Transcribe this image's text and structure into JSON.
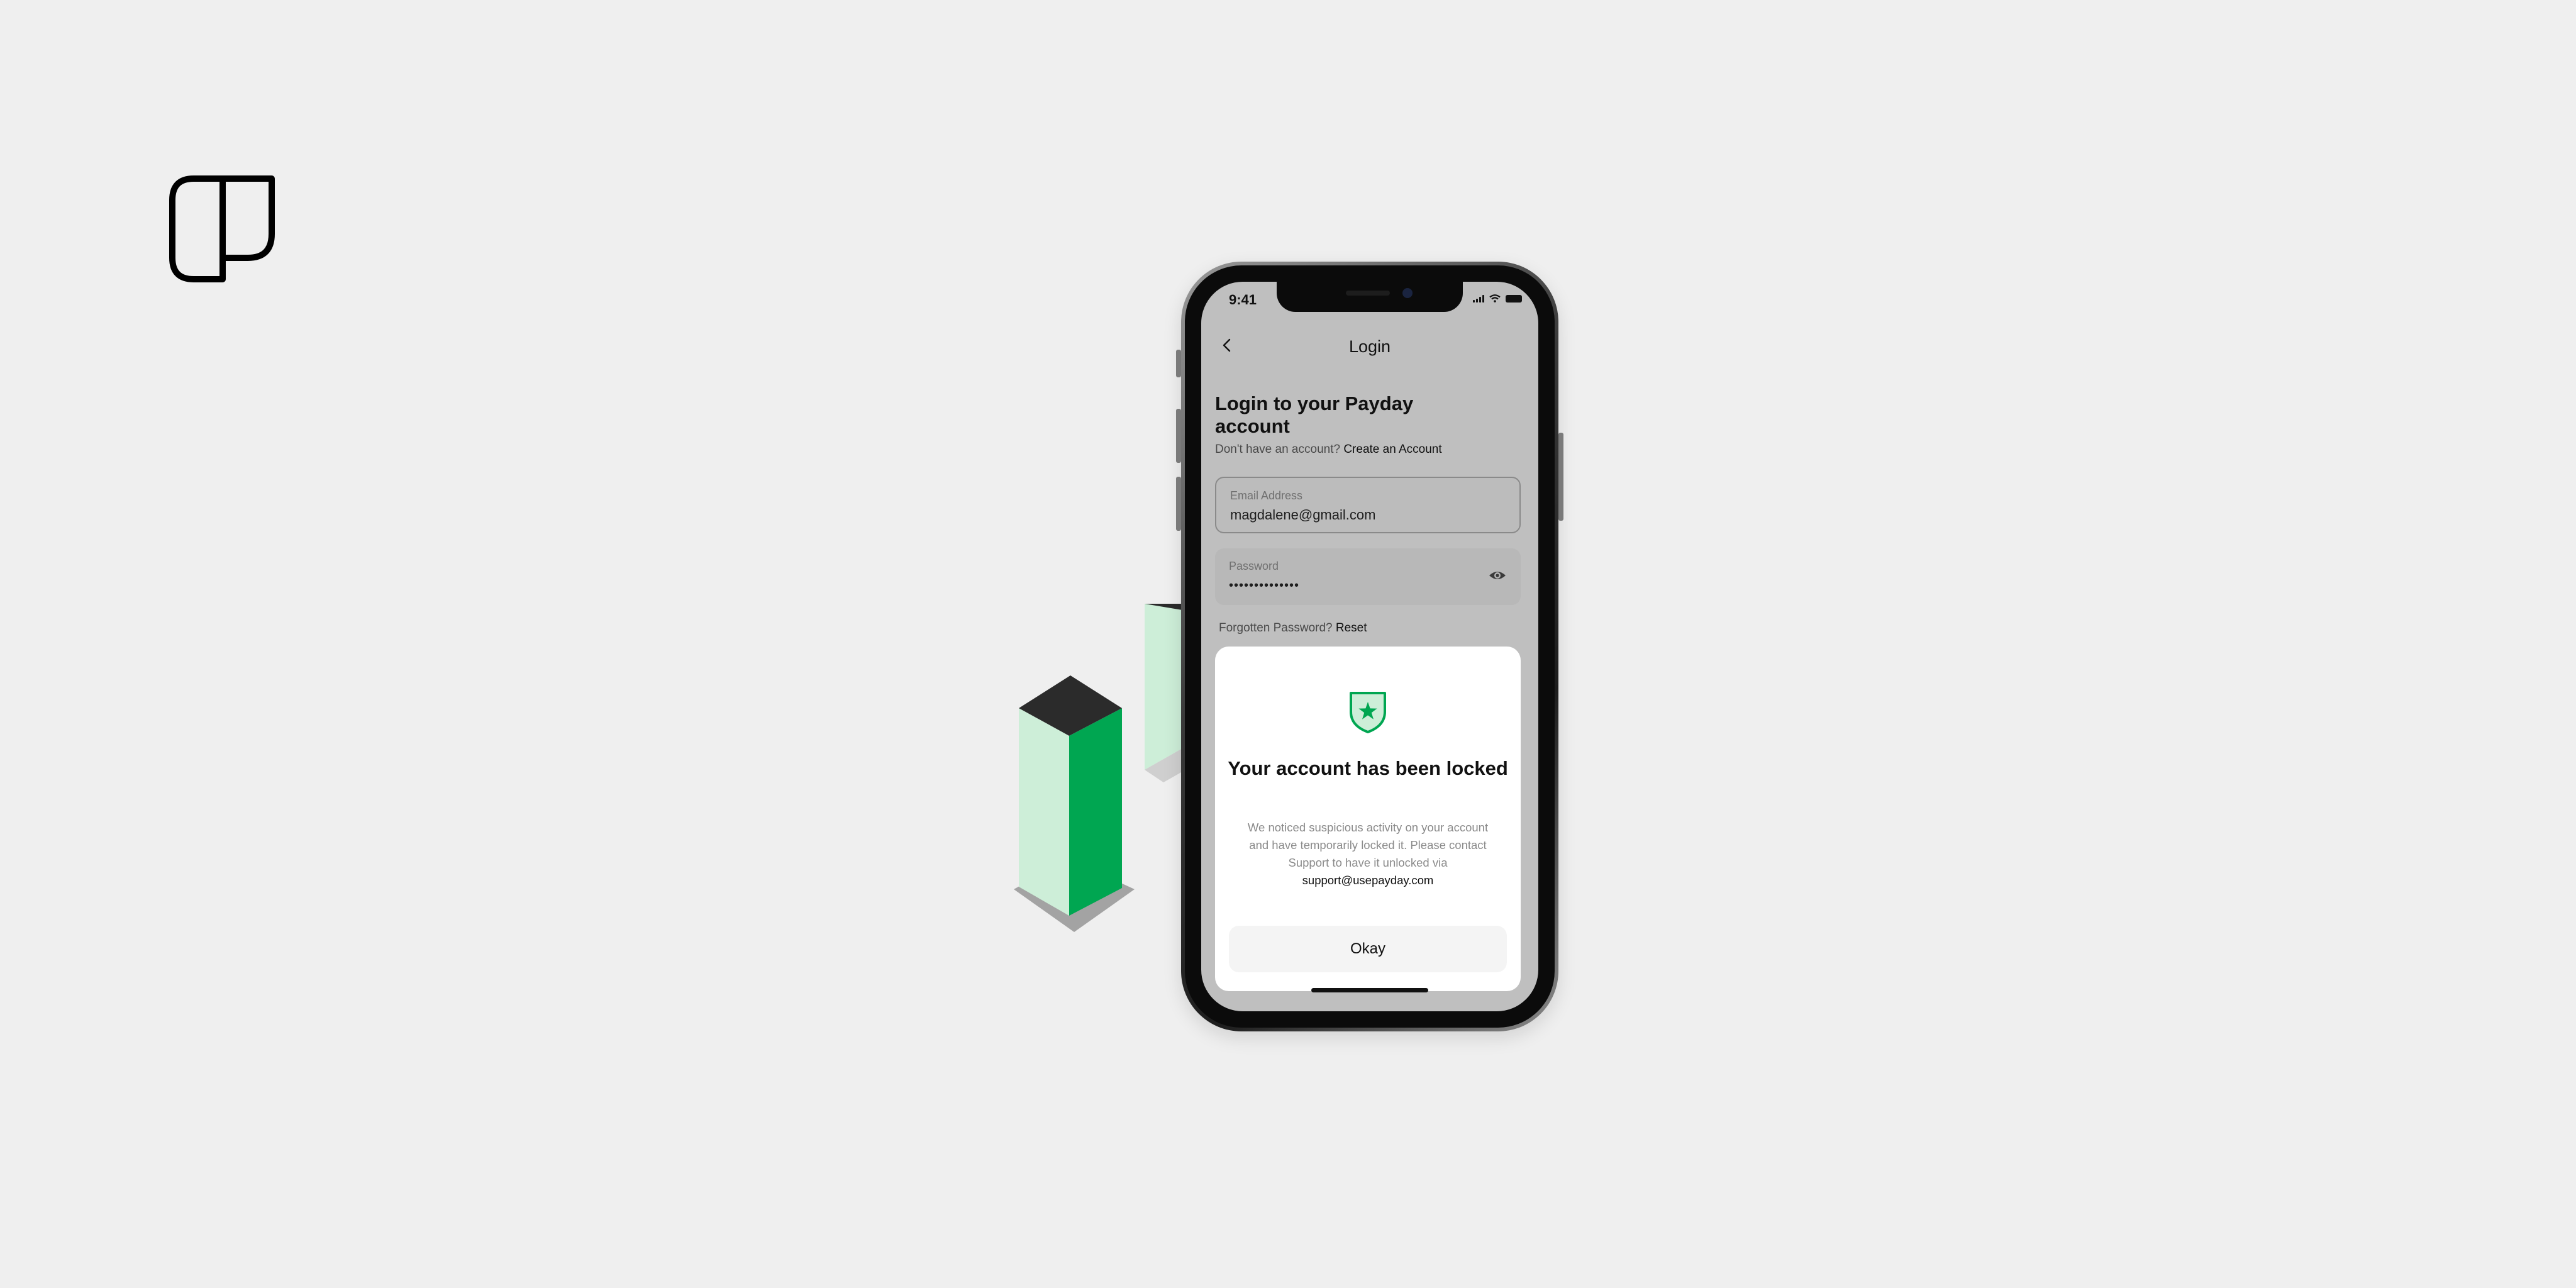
{
  "status_bar": {
    "time": "9:41"
  },
  "nav": {
    "title": "Login",
    "back_icon": "chevron-left-icon"
  },
  "login": {
    "heading": "Login to your Payday account",
    "no_account_text": "Don't have an account?",
    "create_account_link": "Create an Account",
    "email": {
      "label": "Email Address",
      "value": "magdalene@gmail.com"
    },
    "password": {
      "label": "Password",
      "value": "••••••••••••••",
      "toggle_icon": "eye-icon"
    },
    "forgot_text": "Forgotten Password?",
    "reset_link": "Reset"
  },
  "locked_dialog": {
    "icon": "shield-star-icon",
    "title": "Your account has been locked",
    "body": "We noticed suspicious activity on your account and have temporarily locked it. Please contact Support to have it unlocked via",
    "support_email": "support@usepayday.com",
    "okay_label": "Okay"
  },
  "colors": {
    "background": "#efefef",
    "accent_green": "#00a651",
    "light_green": "#cdeed8",
    "dark": "#2b2b2b"
  }
}
